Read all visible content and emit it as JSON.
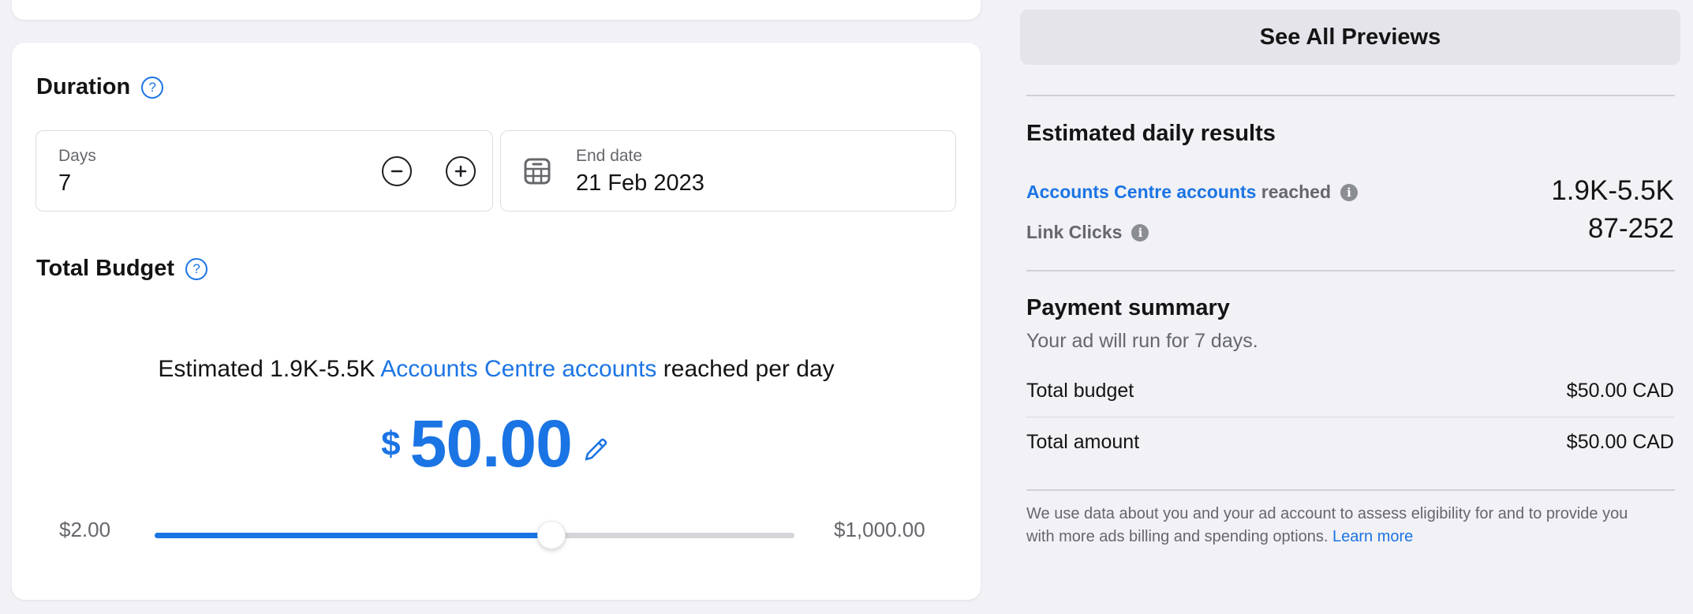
{
  "duration": {
    "title": "Duration",
    "help_icon": "question-circle-icon",
    "days_label": "Days",
    "days_value": "7",
    "decrement_icon": "minus-circle-icon",
    "increment_icon": "plus-circle-icon",
    "end_date_label": "End date",
    "end_date_value": "21 Feb 2023",
    "calendar_icon": "calendar-icon"
  },
  "budget": {
    "title": "Total Budget",
    "help_icon": "question-circle-icon",
    "estimate_prefix": "Estimated 1.9K-5.5K",
    "estimate_link": "Accounts Centre accounts",
    "estimate_suffix": "reached per day",
    "currency_symbol": "$",
    "amount": "50.00",
    "edit_icon": "pencil-icon",
    "slider": {
      "min_label": "$2.00",
      "max_label": "$1,000.00",
      "fill_fraction": 0.62
    }
  },
  "sidebar": {
    "previews_button": "See All Previews",
    "daily_results": {
      "title": "Estimated daily results",
      "reach_link": "Accounts Centre accounts",
      "reach_suffix": "reached",
      "reach_value": "1.9K-5.5K",
      "clicks_label": "Link Clicks",
      "clicks_value": "87-252",
      "info_icon": "info-icon"
    },
    "payment": {
      "title": "Payment summary",
      "subtitle": "Your ad will run for 7 days.",
      "rows": [
        {
          "label": "Total budget",
          "value": "$50.00 CAD"
        },
        {
          "label": "Total amount",
          "value": "$50.00 CAD"
        }
      ]
    },
    "disclaimer": {
      "text": "We use data about you and your ad account to assess eligibility for and to provide you with more ads billing and spending options.",
      "link": "Learn more"
    }
  },
  "colors": {
    "accent": "#1b74e4",
    "background": "#f1f1f6",
    "card": "#ffffff"
  }
}
